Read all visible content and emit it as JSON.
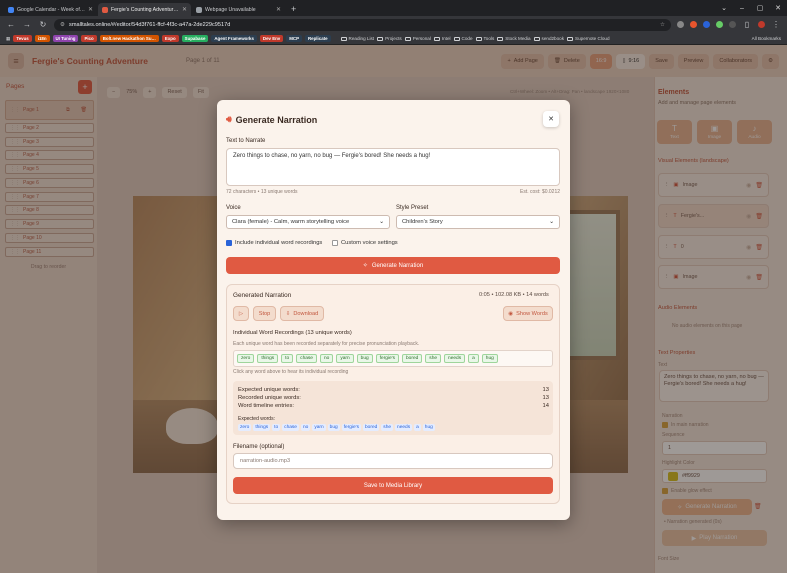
{
  "browser": {
    "tabs": [
      {
        "title": "Google Calendar - Week of Ja…",
        "favicon_color": "#4285f4",
        "active": false
      },
      {
        "title": "Fergie's Counting Adventure -",
        "favicon_color": "#e05a42",
        "active": true
      },
      {
        "title": "Webpage Unavailable",
        "favicon_color": "#9aa0a6",
        "active": false
      }
    ],
    "url": "smalltales.online/#/editor/54d3f761-ffcf-4f3c-a47a-2de229c9517d",
    "bookmarks_chips": [
      {
        "label": "Tevus",
        "color": "#c0392b"
      },
      {
        "label": "i18n",
        "color": "#d35400"
      },
      {
        "label": "UI Tuning",
        "color": "#8e44ad"
      },
      {
        "label": "Pico",
        "color": "#c0392b"
      },
      {
        "label": "Bolt.new Hackathon Su…",
        "color": "#d35400"
      },
      {
        "label": "Expo",
        "color": "#c0392b"
      },
      {
        "label": "Supabase",
        "color": "#27ae60"
      },
      {
        "label": "Agent Frameworks",
        "color": "#2c3e50"
      },
      {
        "label": "Dev Env",
        "color": "#c0392b"
      },
      {
        "label": "MCP",
        "color": "#2c3e50"
      },
      {
        "label": "Replicate",
        "color": "#2c3e50"
      }
    ],
    "bookmark_links": [
      "Reading List",
      "Projects",
      "Personal",
      "Intel",
      "Code",
      "Tools",
      "Stock Media",
      "send2book",
      "Supernote Cloud"
    ],
    "all_bookmarks": "All Bookmarks"
  },
  "app": {
    "title": "Fergie's Counting Adventure",
    "page_indicator": "Page 1 of 11",
    "add_page": "Add Page",
    "delete": "Delete",
    "ratio_a": "16:9",
    "ratio_b": "9:16",
    "save": "Save",
    "preview": "Preview",
    "collaborators": "Collaborators"
  },
  "sidebar": {
    "heading": "Pages",
    "pages": [
      "Page 1",
      "Page 2",
      "Page 3",
      "Page 4",
      "Page 5",
      "Page 6",
      "Page 7",
      "Page 8",
      "Page 9",
      "Page 10",
      "Page 11"
    ],
    "hint": "Drag to reorder"
  },
  "canvas": {
    "zoom": "75%",
    "reset": "Reset",
    "fit": "Fit",
    "info": "Ctrl+Wheel: Zoom • Alt+Drag: Pan • landscape 1920×1080"
  },
  "right_panel": {
    "elements_title": "Elements",
    "elements_sub": "Add and manage page elements",
    "add_buttons": [
      "Text",
      "Image",
      "Audio"
    ],
    "visual_title": "Visual Elements (landscape)",
    "visual_items": [
      "Image",
      "Fergie's...",
      "0",
      "Image"
    ],
    "audio_title": "Audio Elements",
    "audio_empty": "No audio elements on this page",
    "text_props_title": "Text Properties",
    "text_label": "Text",
    "text_value": "Zero things to chase, no yarn, no bug — Fergie's bored! She needs a hug!",
    "narration_label": "Narration",
    "in_main_narration": "In main narration",
    "sequence_label": "Sequence",
    "sequence_value": "1",
    "highlight_label": "Highlight Color",
    "highlight_value": "#ff9929",
    "highlight_color": "#d8c21e",
    "glow_label": "Enable glow effect",
    "generate_narration": "Generate Narration",
    "generated_note": "• Narration generated (0s)",
    "play_narration": "Play Narration",
    "font_size_label": "Font Size"
  },
  "modal": {
    "title": "Generate Narration",
    "text_label": "Text to Narrate",
    "text_value": "Zero things to chase, no yarn, no bug — Fergie's bored! She needs a hug!",
    "char_count": "72 characters • 13 unique words",
    "est_cost": "Est. cost: $0.0212",
    "voice_label": "Voice",
    "voice_value": "Clara (female) - Calm, warm storytelling voice",
    "style_label": "Style Preset",
    "style_value": "Children's Story",
    "include_words": "Include individual word recordings",
    "custom_voice": "Custom voice settings",
    "generate_button": "Generate Narration",
    "generated_title": "Generated Narration",
    "generated_meta": "0:05 • 102.08 KB • 14 words",
    "stop": "Stop",
    "download": "Download",
    "show_words": "Show Words",
    "recordings_title": "Individual Word Recordings (13 unique words)",
    "recordings_sub": "Each unique word has been recorded separately for precise pronunciation playback.",
    "words": [
      "zero",
      "things",
      "to",
      "chase",
      "no",
      "yarn",
      "bug",
      "fergie's",
      "bored",
      "she",
      "needs",
      "a",
      "hug"
    ],
    "words_hint": "Click any word above to hear its individual recording",
    "stats": [
      {
        "label": "Expected unique words:",
        "value": "13"
      },
      {
        "label": "Recorded unique words:",
        "value": "13"
      },
      {
        "label": "Word timeline entries:",
        "value": "14"
      }
    ],
    "expected_label": "Expected words:",
    "expected_words": [
      "zero",
      "things",
      "to",
      "chase",
      "no",
      "yarn",
      "bug",
      "fergie's",
      "bored",
      "she",
      "needs",
      "a",
      "hug"
    ],
    "filename_label": "Filename (optional)",
    "filename_placeholder": "narration-audio.mp3",
    "save_button": "Save to Media Library"
  }
}
